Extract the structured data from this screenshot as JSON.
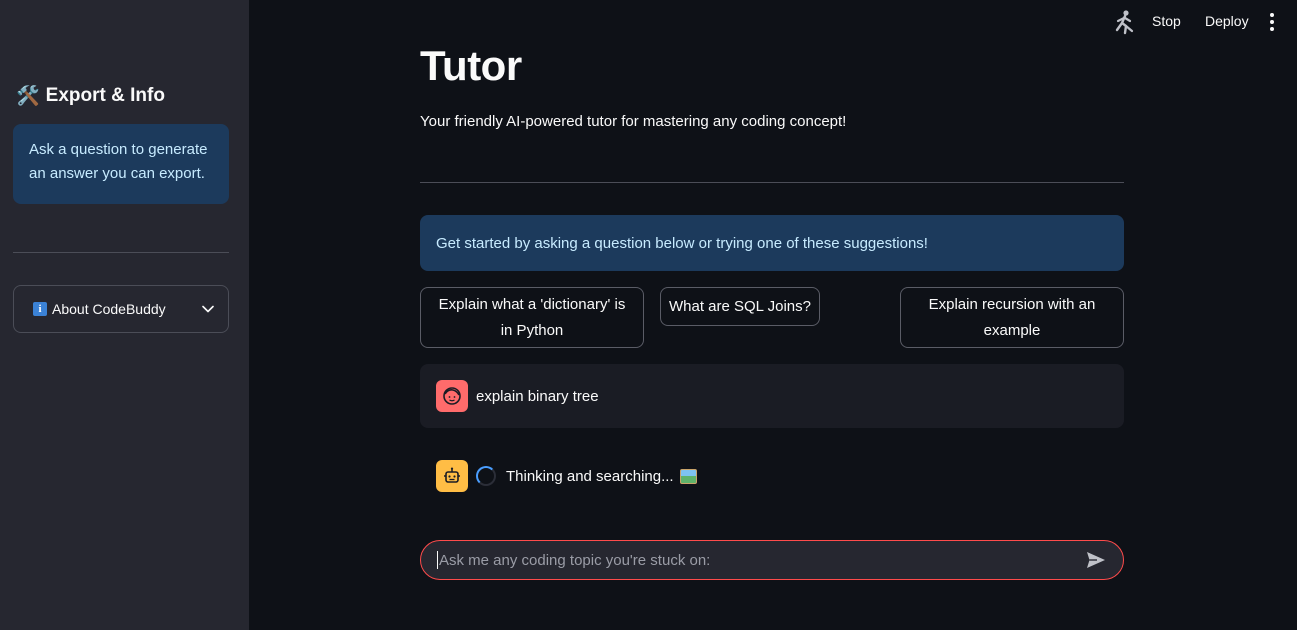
{
  "sidebar": {
    "header_emoji": "🛠️",
    "header_title": "Export & Info",
    "info_text": "Ask a question to generate an answer you can export.",
    "expander_label": "About CodeBuddy"
  },
  "topbar": {
    "stop_label": "Stop",
    "deploy_label": "Deploy"
  },
  "main": {
    "title": "Tutor",
    "subtitle": "Your friendly AI-powered tutor for mastering any coding concept!",
    "banner": "Get started by asking a question below or trying one of these suggestions!",
    "suggestions": [
      "Explain what a 'dictionary' is in Python",
      "What are SQL Joins?",
      "Explain recursion with an example"
    ],
    "messages": [
      {
        "role": "user",
        "text": "explain binary tree"
      },
      {
        "role": "assistant",
        "text": "Thinking and searching..."
      }
    ],
    "chat_input": {
      "placeholder": "Ask me any coding topic you're stuck on:",
      "value": ""
    }
  },
  "colors": {
    "background": "#0e1117",
    "sidebar": "#262730",
    "info_bg": "#1c3a5c",
    "accent": "#ff4b4b",
    "user_avatar": "#ff6b6b",
    "bot_avatar": "#ffbd45"
  }
}
